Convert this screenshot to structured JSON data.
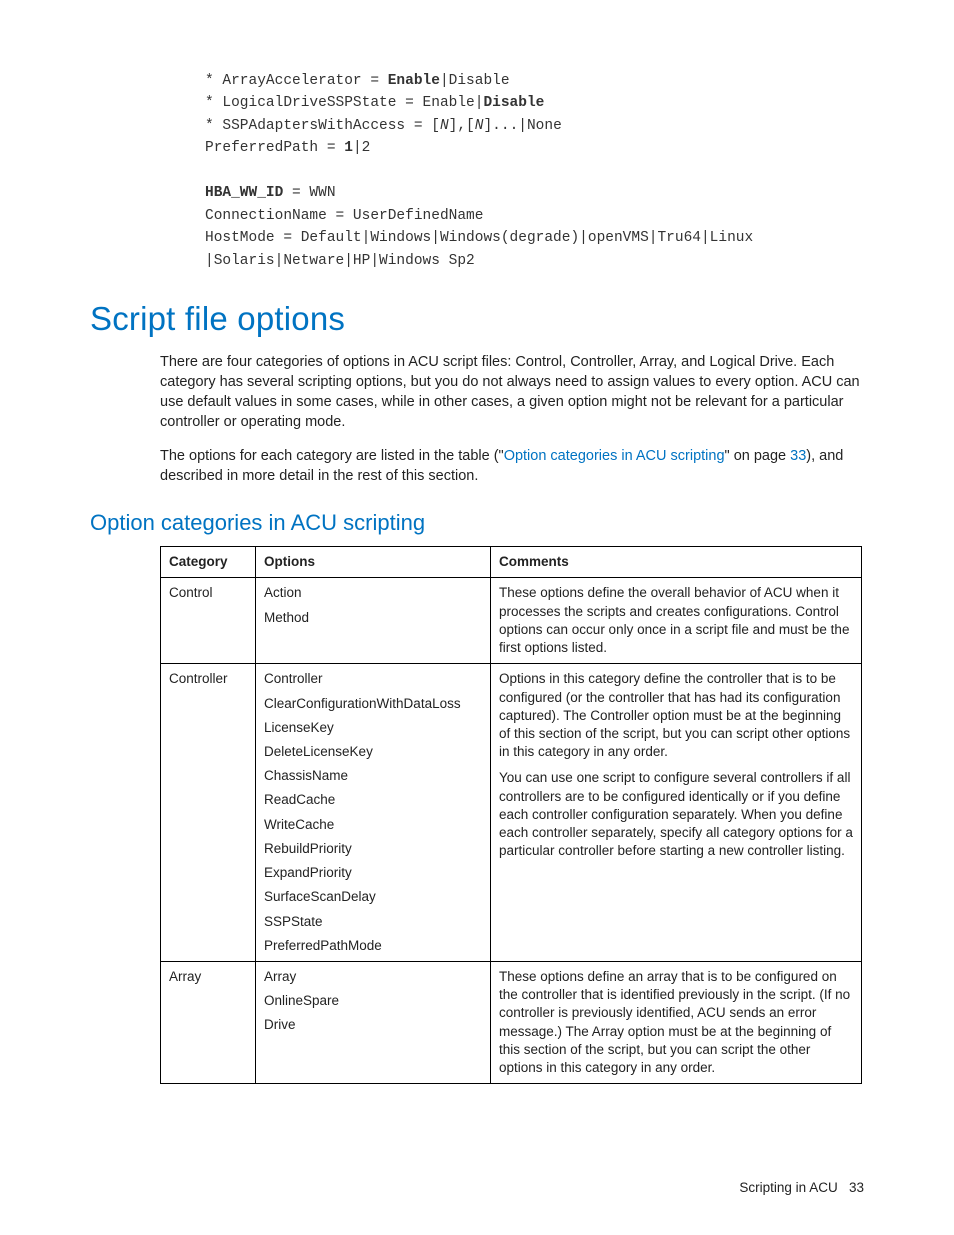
{
  "code_block": {
    "l1_pre": "* ArrayAccelerator = ",
    "l1_bold": "Enable",
    "l1_post": "|Disable",
    "l2_pre": "* LogicalDriveSSPState = Enable|",
    "l2_bold": "Disable",
    "l3_pre": "* SSPAdaptersWithAccess = [",
    "l3_it1": "N",
    "l3_mid": "],[",
    "l3_it2": "N",
    "l3_post": "]...|None",
    "l4_pre": "PreferredPath = ",
    "l4_bold": "1",
    "l4_post": "|2",
    "l6_bold": "HBA_WW_ID",
    "l6_post": " = WWN",
    "l7": "ConnectionName = UserDefinedName",
    "l8": "HostMode = Default|Windows|Windows(degrade)|openVMS|Tru64|Linux",
    "l9": "|Solaris|Netware|HP|Windows Sp2"
  },
  "heading": "Script file options",
  "para1": "There are four categories of options in ACU script files: Control, Controller, Array, and Logical Drive. Each category has several scripting options, but you do not always need to assign values to every option. ACU can use default values in some cases, while in other cases, a given option might not be relevant for a particular controller or operating mode.",
  "para2_pre": "The options for each category are listed in the table (\"",
  "para2_link": "Option categories in ACU scripting",
  "para2_mid": "\" on page ",
  "para2_page": "33",
  "para2_post": "), and described in more detail in the rest of this section.",
  "subheading": "Option categories in ACU scripting",
  "table": {
    "headers": {
      "c1": "Category",
      "c2": "Options",
      "c3": "Comments"
    },
    "rows": [
      {
        "category": "Control",
        "options": [
          "Action",
          "Method"
        ],
        "comments": [
          "These options define the overall behavior of ACU when it processes the scripts and creates configurations. Control options can occur only once in a script file and must be the first options listed."
        ]
      },
      {
        "category": "Controller",
        "options": [
          "Controller",
          "ClearConfigurationWithDataLoss",
          "LicenseKey",
          "DeleteLicenseKey",
          "ChassisName",
          "ReadCache",
          "WriteCache",
          "RebuildPriority",
          "ExpandPriority",
          "SurfaceScanDelay",
          "SSPState",
          "PreferredPathMode"
        ],
        "comments": [
          "Options in this category define the controller that is to be configured (or the controller that has had its configuration captured). The Controller option must be at the beginning of this section of the script, but you can script other options in this category in any order.",
          "You can use one script to configure several controllers if all controllers are to be configured identically or if you define each controller configuration separately. When you define each controller separately, specify all category options for a particular controller before starting a new controller listing."
        ]
      },
      {
        "category": "Array",
        "options": [
          "Array",
          "OnlineSpare",
          "Drive"
        ],
        "comments": [
          "These options define an array that is to be configured on the controller that is identified previously in the script. (If no controller is previously identified, ACU sends an error message.) The Array option must be at the beginning of this section of the script, but you can script the other options in this category in any order."
        ]
      }
    ]
  },
  "footer": {
    "label": "Scripting in ACU",
    "page": "33"
  }
}
